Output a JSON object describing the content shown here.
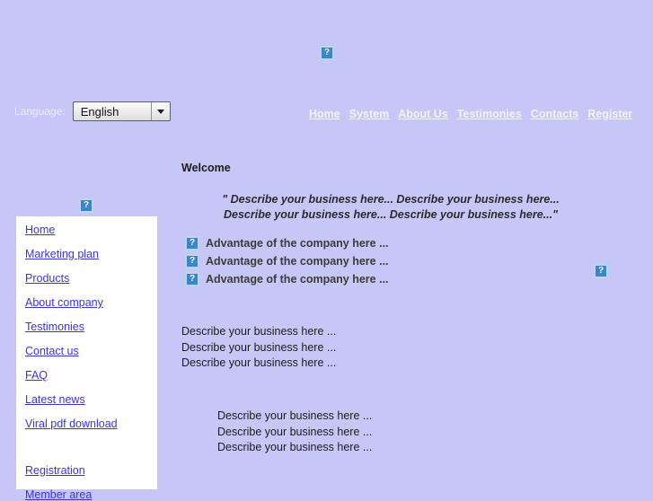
{
  "page": {
    "background_color": "#c6c6f7",
    "title": "Welcome"
  },
  "top_logo": {
    "icon": "broken-image-icon",
    "alt": "?"
  },
  "language_bar": {
    "label": "Language:",
    "selected": "English",
    "options": [
      "English"
    ],
    "caret_icon": "chevron-down-icon"
  },
  "top_nav": {
    "items": [
      {
        "label": "Home"
      },
      {
        "label": "System"
      },
      {
        "label": "About Us"
      },
      {
        "label": "Testimonies"
      },
      {
        "label": "Contacts"
      },
      {
        "label": "Register"
      }
    ],
    "link_color": "#f2f2ff"
  },
  "sidebar": {
    "logo_icon": "broken-image-icon",
    "background_color": "#ffffff",
    "link_color": "#3a34d6",
    "items": [
      {
        "label": "Home"
      },
      {
        "label": "Marketing plan"
      },
      {
        "label": "Products"
      },
      {
        "label": "About company"
      },
      {
        "label": "Testimonies"
      },
      {
        "label": "Contact us"
      },
      {
        "label": "FAQ"
      },
      {
        "label": "Latest news"
      },
      {
        "label": "Viral pdf download"
      }
    ],
    "items_secondary": [
      {
        "label": "Registration"
      },
      {
        "label": "Member area"
      }
    ]
  },
  "main": {
    "heading": "Welcome",
    "quote": {
      "line1": "\" Describe your business here... Describe your business here...",
      "line2": "Describe your business here... Describe your business here...\""
    },
    "advantages": [
      {
        "icon": "broken-image-icon",
        "label": "Advantage of the company here ..."
      },
      {
        "icon": "broken-image-icon",
        "label": "Advantage of the company here ..."
      },
      {
        "icon": "broken-image-icon",
        "label": "Advantage of the company here ..."
      }
    ],
    "paragraph_1": [
      "Describe your business here ...",
      "Describe your business here ...",
      "Describe your business here ..."
    ],
    "paragraph_2": [
      "Describe your business here ...",
      "Describe your business here ...",
      "Describe your business here ..."
    ],
    "right_logo_icon": "broken-image-icon"
  }
}
